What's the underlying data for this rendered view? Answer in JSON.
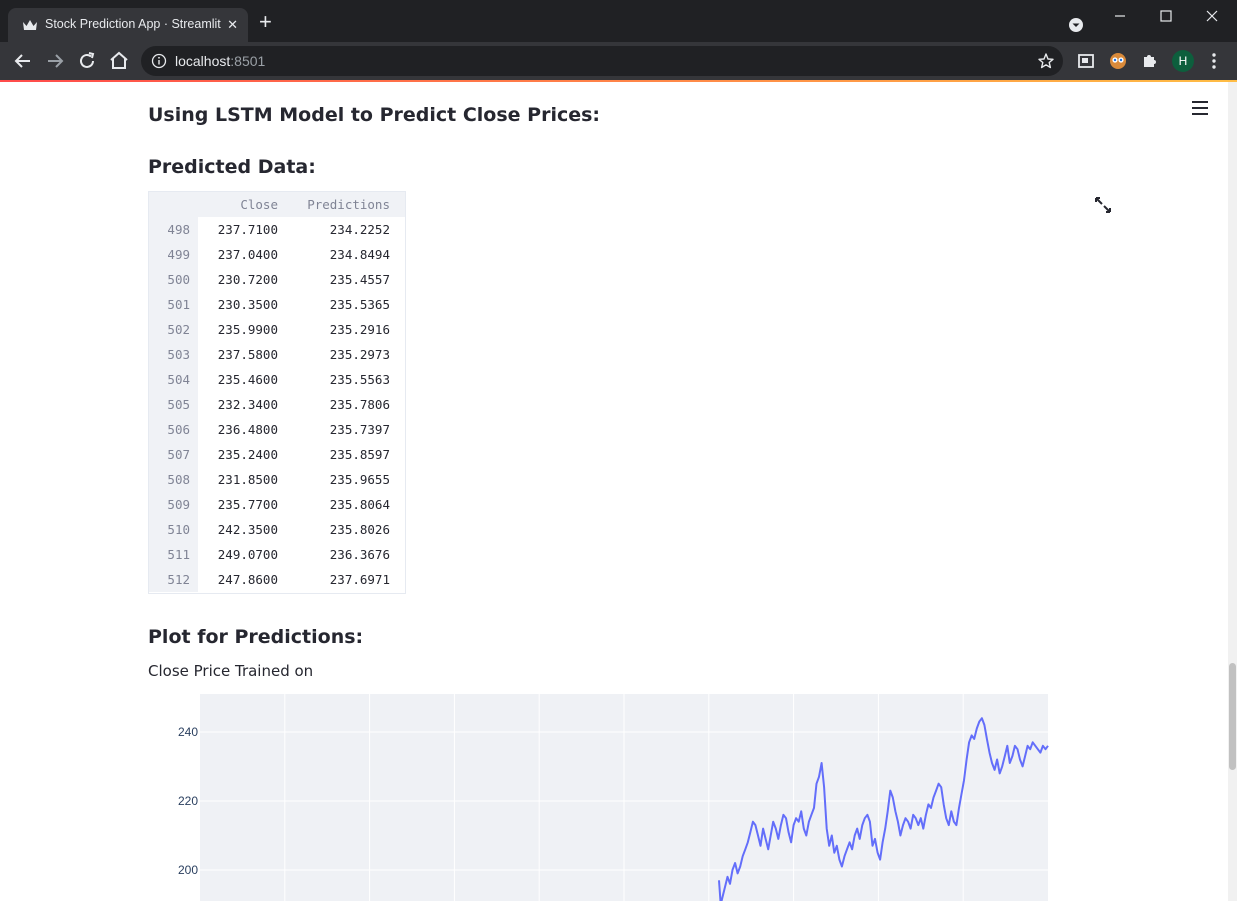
{
  "browser": {
    "tab_title": "Stock Prediction App · Streamlit",
    "tab_close": "✕",
    "new_tab": "+",
    "url_host": "localhost",
    "url_port": ":8501",
    "profile_initial": "H"
  },
  "main": {
    "heading_model": "Using LSTM Model to Predict Close Prices:",
    "heading_predicted": "Predicted Data:",
    "heading_plot": "Plot for Predictions:",
    "plot_caption": "Close Price Trained on"
  },
  "table": {
    "columns": [
      "Close",
      "Predictions"
    ],
    "rows": [
      {
        "index": "498",
        "close": "237.7100",
        "pred": "234.2252"
      },
      {
        "index": "499",
        "close": "237.0400",
        "pred": "234.8494"
      },
      {
        "index": "500",
        "close": "230.7200",
        "pred": "235.4557"
      },
      {
        "index": "501",
        "close": "230.3500",
        "pred": "235.5365"
      },
      {
        "index": "502",
        "close": "235.9900",
        "pred": "235.2916"
      },
      {
        "index": "503",
        "close": "237.5800",
        "pred": "235.2973"
      },
      {
        "index": "504",
        "close": "235.4600",
        "pred": "235.5563"
      },
      {
        "index": "505",
        "close": "232.3400",
        "pred": "235.7806"
      },
      {
        "index": "506",
        "close": "236.4800",
        "pred": "235.7397"
      },
      {
        "index": "507",
        "close": "235.2400",
        "pred": "235.8597"
      },
      {
        "index": "508",
        "close": "231.8500",
        "pred": "235.9655"
      },
      {
        "index": "509",
        "close": "235.7700",
        "pred": "235.8064"
      },
      {
        "index": "510",
        "close": "242.3500",
        "pred": "235.8026"
      },
      {
        "index": "511",
        "close": "249.0700",
        "pred": "236.3676"
      },
      {
        "index": "512",
        "close": "247.8600",
        "pred": "237.6971"
      }
    ]
  },
  "chart_data": {
    "type": "line",
    "y_ticks": [
      "240",
      "220",
      "200"
    ],
    "ylim": [
      191,
      251
    ],
    "xlim": [
      0,
      1000
    ],
    "line_color": "#636efa",
    "plot_bg": "#eff1f5",
    "grid": true,
    "series": [
      {
        "x": [
          612,
          614,
          616,
          618,
          620,
          622,
          625,
          628,
          631,
          634,
          637,
          640,
          643,
          646,
          649,
          652,
          655,
          658,
          661,
          664,
          667,
          670,
          673,
          676,
          679,
          682,
          685,
          688,
          691,
          694,
          697,
          700,
          703,
          706,
          709,
          712,
          715,
          718,
          721,
          724,
          727,
          730,
          733,
          736,
          739,
          742,
          745,
          748,
          751,
          754,
          757,
          760,
          763,
          766,
          769,
          772,
          775,
          778,
          781,
          784,
          787,
          790,
          793,
          796,
          799,
          802,
          805,
          808,
          811,
          814,
          817,
          820,
          823,
          826,
          829,
          832,
          835,
          838,
          841,
          844,
          847,
          850,
          853,
          856,
          859,
          862,
          865,
          868,
          871,
          874,
          877,
          880,
          883,
          886,
          889,
          892,
          895,
          898,
          901,
          904,
          907,
          910,
          913,
          916,
          919,
          922,
          925,
          928,
          931,
          934,
          937,
          940,
          943,
          946,
          949,
          952,
          955,
          958,
          961,
          964,
          967,
          970,
          973,
          976,
          979,
          982,
          985,
          988,
          991,
          994,
          997,
          1000
        ],
        "y": [
          197,
          190,
          192,
          194,
          196,
          198,
          196,
          200,
          202,
          199,
          201,
          204,
          206,
          208,
          211,
          214,
          213,
          210,
          207,
          212,
          209,
          206,
          210,
          214,
          212,
          209,
          213,
          216,
          215,
          211,
          208,
          213,
          215,
          214,
          217,
          212,
          210,
          214,
          216,
          218,
          225,
          227,
          231,
          224,
          212,
          207,
          210,
          205,
          207,
          203,
          201,
          204,
          206,
          208,
          206,
          210,
          212,
          209,
          213,
          215,
          216,
          214,
          207,
          209,
          205,
          203,
          208,
          212,
          217,
          223,
          221,
          217,
          214,
          210,
          213,
          215,
          214,
          212,
          216,
          215,
          213,
          215,
          212,
          216,
          219,
          218,
          221,
          223,
          225,
          224,
          219,
          215,
          213,
          217,
          214,
          213,
          218,
          222,
          226,
          232,
          237,
          239,
          238,
          241,
          243,
          244,
          242,
          238,
          234,
          231,
          229,
          232,
          228,
          230,
          233,
          236,
          231,
          233,
          236,
          235,
          232,
          230,
          233,
          236,
          235,
          237,
          236,
          235,
          234,
          236,
          235,
          236
        ]
      }
    ]
  },
  "icons": [
    "streamlit-crown-icon",
    "back-arrow-icon",
    "forward-arrow-icon",
    "reload-icon",
    "home-icon",
    "info-icon",
    "star-icon",
    "media-icon",
    "extension-icon",
    "puzzle-icon",
    "menu-dots-icon",
    "hamburger-menu-icon",
    "fullscreen-expand-icon",
    "minimize-icon",
    "maximize-icon",
    "close-icon",
    "tab-search-icon"
  ]
}
